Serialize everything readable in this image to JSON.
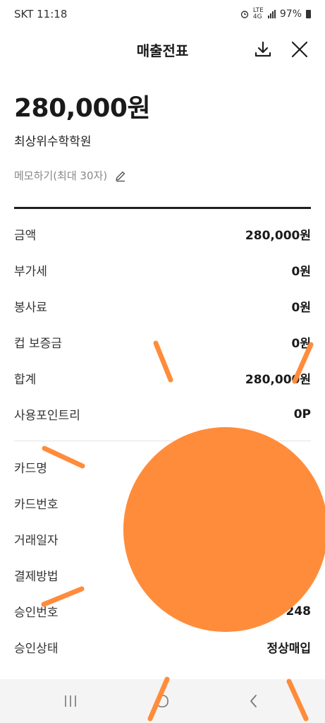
{
  "status": {
    "carrier": "SKT",
    "time": "11:18",
    "network_top": "LTE",
    "network_bottom": "4G",
    "battery": "97%"
  },
  "header": {
    "title": "매출전표"
  },
  "receipt": {
    "amount": "280,000원",
    "merchant": "최상위수학학원",
    "memo_label": "메모하기(최대 30자)"
  },
  "details": [
    {
      "key": "금액",
      "value": "280,000원"
    },
    {
      "key": "부가세",
      "value": "0원"
    },
    {
      "key": "봉사료",
      "value": "0원"
    },
    {
      "key": "컵 보증금",
      "value": "0원"
    },
    {
      "key": "합계",
      "value": "280,000원"
    },
    {
      "key": "사용포인트리",
      "value": "0P"
    }
  ],
  "card_details": [
    {
      "key": "카드명",
      "value": ""
    },
    {
      "key": "카드번호",
      "value": ""
    },
    {
      "key": "거래일자",
      "value": ""
    },
    {
      "key": "결제방법",
      "value": ""
    },
    {
      "key": "승인번호",
      "value": "248"
    },
    {
      "key": "승인상태",
      "value": "정상매입"
    }
  ],
  "colors": {
    "overlay": "#ff8c3b",
    "divider": "#1f1f1f",
    "nav_bg": "#f4f4f4"
  },
  "icons": {
    "download": "download-icon",
    "close": "close-icon",
    "edit": "pencil-icon",
    "recent": "recent-apps-icon",
    "home": "home-icon",
    "back": "back-icon"
  }
}
